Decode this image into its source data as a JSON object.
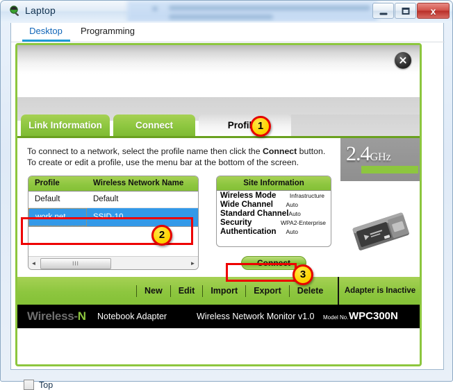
{
  "window": {
    "title": "Laptop",
    "icon": "laptop-magnifier-icon",
    "minimize_label": "",
    "maximize_label": "",
    "close_label": "x"
  },
  "outer_tabs": [
    {
      "label": "Desktop",
      "active": true
    },
    {
      "label": "Programming",
      "active": false
    }
  ],
  "app": {
    "tabs": [
      {
        "label": "Link Information",
        "active": false
      },
      {
        "label": "Connect",
        "active": false
      },
      {
        "label": "Profiles",
        "active": true
      }
    ],
    "intro_part1": "To connect to a network, select the profile name then click the ",
    "intro_bold": "Connect",
    "intro_part2": " button. To create or edit a profile, use the menu bar at the bottom of the screen.",
    "profiles_table": {
      "headers": [
        "Profile",
        "Wireless Network Name"
      ],
      "rows": [
        {
          "profile": "Default",
          "ssid": "Default",
          "selected": false
        },
        {
          "profile": "work net",
          "ssid": "SSID-10",
          "selected": true
        }
      ],
      "scrollbar": {
        "left_arrow": "◄",
        "right_arrow": "►",
        "grip": "III"
      }
    },
    "site_information": {
      "title": "Site Information",
      "rows": [
        {
          "label": "Wireless Mode",
          "value": "Infrastructure"
        },
        {
          "label": "Wide Channel",
          "value": "Auto"
        },
        {
          "label": "Standard Channel",
          "value": "Auto"
        },
        {
          "label": "Security",
          "value": "WPA2-Enterprise"
        },
        {
          "label": "Authentication",
          "value": "Auto"
        }
      ]
    },
    "connect_button": "Connect",
    "band_panel": {
      "number": "2.4",
      "unit": "GHz"
    },
    "menu_items": [
      "New",
      "Edit",
      "Import",
      "Export",
      "Delete"
    ],
    "adapter_status": "Adapter is Inactive",
    "footer": {
      "brand_prefix": "Wireless-",
      "brand_suffix": "N",
      "product": "Notebook Adapter",
      "monitor": "Wireless Network Monitor  v1.0",
      "model_label": "Model No.",
      "model": "WPC300N"
    }
  },
  "bottom": {
    "top_checkbox_label": "Top"
  },
  "callouts": [
    {
      "number": "1",
      "target": "profiles-tab"
    },
    {
      "number": "2",
      "target": "selected-profile-row"
    },
    {
      "number": "3",
      "target": "connect-button"
    }
  ],
  "colors": {
    "brand_green": "#8dc63f",
    "selection_blue": "#3399e8",
    "callout_yellow": "#ffd400",
    "callout_red": "#ee0000",
    "active_tab_blue": "#1e9ad6"
  }
}
